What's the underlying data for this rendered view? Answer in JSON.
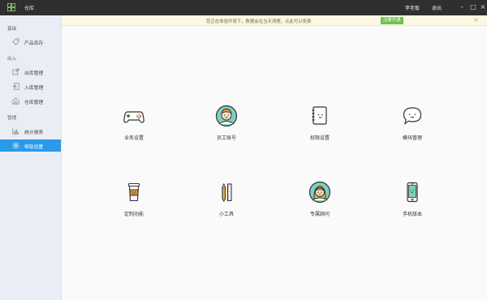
{
  "titlebar": {
    "app_title": "仓库",
    "user_name": "李老板",
    "logout": "退出",
    "app_icon": "grid-icon"
  },
  "notice": {
    "text": "您正在体验环境下，数据会在当天清理，点此可以免费",
    "button": "注册开通",
    "close_icon": "close-icon"
  },
  "sidebar": {
    "groups": [
      {
        "label": "基础",
        "items": [
          {
            "label": "产品库存",
            "icon": "tag-icon"
          }
        ]
      },
      {
        "label": "出入",
        "items": [
          {
            "label": "出库管理",
            "icon": "export-icon"
          },
          {
            "label": "入库管理",
            "icon": "import-icon"
          },
          {
            "label": "仓库管理",
            "icon": "warehouse-icon"
          }
        ]
      },
      {
        "label": "管理",
        "items": [
          {
            "label": "统计报表",
            "icon": "bar-chart-icon"
          },
          {
            "label": "帮助设置",
            "icon": "gear-icon",
            "active": true
          }
        ]
      }
    ]
  },
  "tiles": [
    {
      "label": "业务设置",
      "icon": "gamepad-icon"
    },
    {
      "label": "员工账号",
      "icon": "employee-avatar-icon"
    },
    {
      "label": "权限设置",
      "icon": "notebook-icon"
    },
    {
      "label": "模块管理",
      "icon": "chat-bubble-icon"
    },
    {
      "label": "定制功能",
      "icon": "coffee-cup-icon"
    },
    {
      "label": "小工具",
      "icon": "pencil-ruler-icon"
    },
    {
      "label": "专属顾问",
      "icon": "advisor-avatar-icon"
    },
    {
      "label": "手机版本",
      "icon": "mobile-phone-icon"
    }
  ],
  "colors": {
    "titlebar": "#2f2f2f",
    "sidebar": "#e9eef6",
    "active": "#2b9ae8",
    "notice": "#fcf8e3",
    "notice_button": "#6cc24a"
  }
}
